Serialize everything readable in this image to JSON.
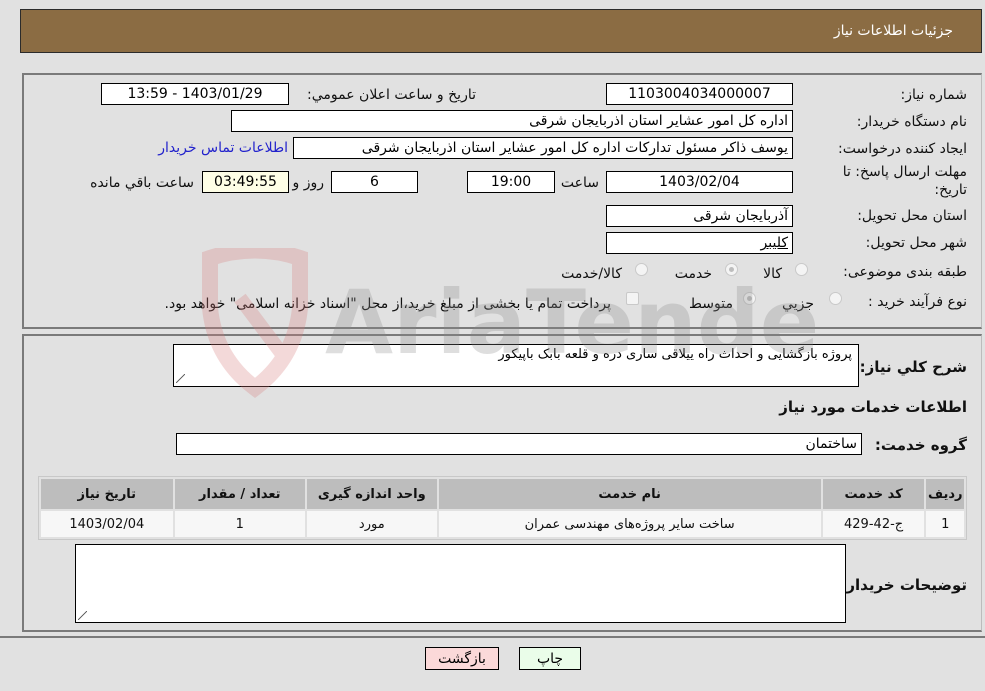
{
  "header": {
    "title": "جزئیات اطلاعات نیاز"
  },
  "details": {
    "need_number_label": "شماره نیاز:",
    "need_number": "1103004034000007",
    "announce_label": "تاریخ و ساعت اعلان عمومي:",
    "announce_value": "1403/01/29 - 13:59",
    "buyer_org_label": "نام دستگاه خريدار:",
    "buyer_org": "اداره کل امور عشایر استان اذربایجان شرقی",
    "creator_label": "ایجاد کننده درخواست:",
    "creator": "یوسف ذاکر مسئول تدارکات اداره کل امور عشایر استان اذربایجان شرقی",
    "contact_link": "اطلاعات تماس خریدار",
    "deadline_label_line1": "مهلت ارسال پاسخ: تا",
    "deadline_label_line2": "تاریخ:",
    "deadline_date": "1403/02/04",
    "time_label": "ساعت",
    "deadline_time": "19:00",
    "days_value": "6",
    "days_label": "روز و",
    "remaining_time": "03:49:55",
    "remaining_label": "ساعت باقي مانده",
    "province_label": "استان محل تحویل:",
    "province": "آذربایجان شرقی",
    "city_label": "شهر محل تحویل:",
    "city": "کلیبر",
    "category_label": "طبقه بندی موضوعی:",
    "category_options": [
      {
        "label": "کالا",
        "checked": false
      },
      {
        "label": "خدمت",
        "checked": true
      },
      {
        "label": "کالا/خدمت",
        "checked": false
      }
    ],
    "process_label": "نوع فرآیند خرید :",
    "process_options": [
      {
        "label": "جزیي",
        "checked": false
      },
      {
        "label": "متوسط",
        "checked": true
      }
    ],
    "treasury_note": "پرداخت تمام یا بخشی از مبلغ خرید،از محل \"اسناد خزانه اسلامی\" خواهد بود.",
    "treasury_checked": false
  },
  "services": {
    "description_label": "شرح کلي نياز:",
    "description": "پروژه بازگشایی و احداث راه ییلاقی ساری دره و قلعه بابک باپیکور",
    "section_title": "اطلاعات خدمات مورد نياز",
    "group_label": "گروه خدمت:",
    "group_value": "ساختمان",
    "table": {
      "columns": [
        "ردیف",
        "کد خدمت",
        "نام خدمت",
        "واحد اندازه گیری",
        "تعداد / مقدار",
        "تاریخ نیاز"
      ],
      "rows": [
        [
          "1",
          "ج-42-429",
          "ساخت سایر پروژه‌های مهندسی عمران",
          "مورد",
          "1",
          "1403/02/04"
        ]
      ]
    },
    "buyer_notes_label": "توضیحات خریدار:",
    "buyer_notes": ""
  },
  "buttons": {
    "print": "چاپ",
    "back": "بازگشت"
  },
  "watermark": {
    "text": "AriaTender.neT"
  },
  "colors": {
    "header_bg": "#8b6c43",
    "back_button_bg": "#fbd9d9",
    "print_button_bg": "#eafde9",
    "link": "#2222cc"
  }
}
